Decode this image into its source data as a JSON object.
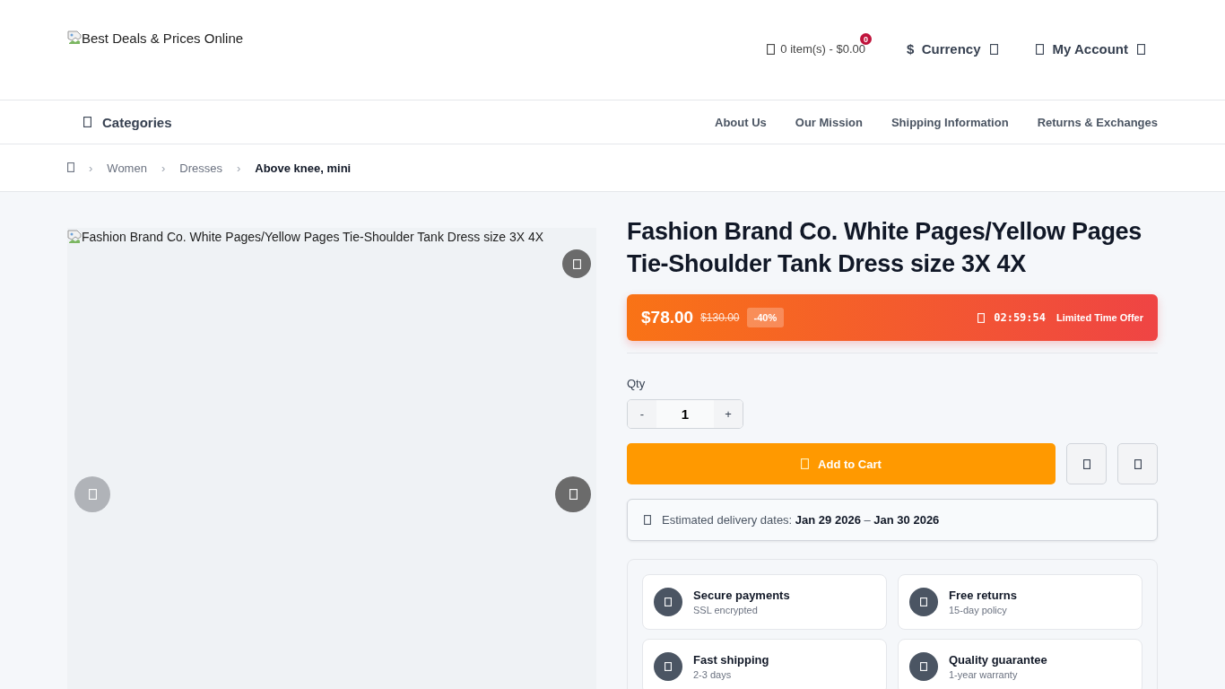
{
  "header": {
    "logo_alt": "Best Deals & Prices Online",
    "cart": {
      "summary": "0 item(s) - $0.00",
      "badge": "0"
    },
    "currency": {
      "symbol": "$",
      "label": "Currency"
    },
    "account": {
      "label": "My Account"
    }
  },
  "nav": {
    "categories": "Categories",
    "links": [
      "About Us",
      "Our Mission",
      "Shipping Information",
      "Returns & Exchanges"
    ]
  },
  "breadcrumb": [
    {
      "separator": "›",
      "label": "Women",
      "current": false
    },
    {
      "separator": "›",
      "label": "Dresses",
      "current": false
    },
    {
      "separator": "›",
      "label": "Above knee, mini",
      "current": true
    }
  ],
  "gallery": {
    "image_alt": "Fashion Brand Co. White Pages/Yellow Pages Tie-Shoulder Tank Dress size 3X 4X",
    "prev": {
      "disabled": true
    },
    "next": {
      "disabled": false
    }
  },
  "product": {
    "title": "Fashion Brand Co. White Pages/Yellow Pages Tie-Shoulder Tank Dress size 3X 4X",
    "price": "$78.00",
    "old_price": "$130.00",
    "discount": "-40%",
    "countdown": "02:59:54",
    "offer": "Limited Time Offer",
    "qty_label": "Qty",
    "qty": "1",
    "minus": "-",
    "plus": "+",
    "add_to_cart": "Add to Cart",
    "delivery": "Estimated delivery dates: **Jan 29 2026** – **Jan 30 2026**"
  },
  "features": [
    {
      "title": "Secure payments",
      "subtitle": "SSL encrypted"
    },
    {
      "title": "Free returns",
      "subtitle": "15-day policy"
    },
    {
      "title": "Fast shipping",
      "subtitle": "2-3 days"
    },
    {
      "title": "Quality guarantee",
      "subtitle": "1-year warranty"
    }
  ]
}
